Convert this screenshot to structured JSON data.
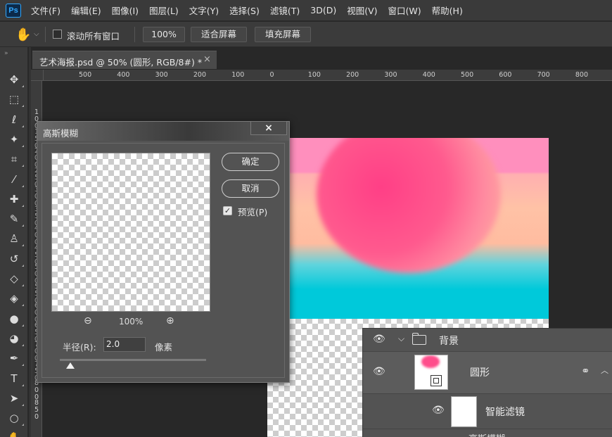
{
  "app": {
    "logo": "Ps"
  },
  "menu": [
    "文件(F)",
    "编辑(E)",
    "图像(I)",
    "图层(L)",
    "文字(Y)",
    "选择(S)",
    "滤镜(T)",
    "3D(D)",
    "视图(V)",
    "窗口(W)",
    "帮助(H)"
  ],
  "options": {
    "tool_icon": "hand-icon",
    "scroll_all_windows": "滚动所有窗口",
    "scroll_all_checked": false,
    "zoom_value": "100%",
    "fit_screen": "适合屏幕",
    "fill_screen": "填充屏幕"
  },
  "document": {
    "tab_title": "艺术海报.psd @ 50% (圆形, RGB/8#) *",
    "close": "×"
  },
  "rulers": {
    "top": [
      "500",
      "400",
      "300",
      "200",
      "100",
      "0",
      "100",
      "200",
      "300",
      "400",
      "500",
      "600",
      "700",
      "800"
    ],
    "left": [
      "1 0 0",
      "1 5 0",
      "2 0 0",
      "2 5 0",
      "3 0 0",
      "3 5 0",
      "4 0 0",
      "4 5 0",
      "5 0 0",
      "5 5 0",
      "6 0 0",
      "6 5 0",
      "7 0 0",
      "7 5 0",
      "8 0 0",
      "8 5 0"
    ]
  },
  "tools": [
    {
      "name": "move-icon",
      "glyph": "✥"
    },
    {
      "name": "marquee-icon",
      "glyph": "⬚"
    },
    {
      "name": "lasso-icon",
      "glyph": "ℓ"
    },
    {
      "name": "magic-wand-icon",
      "glyph": "✦"
    },
    {
      "name": "crop-icon",
      "glyph": "⌗"
    },
    {
      "name": "eyedropper-icon",
      "glyph": "⁄"
    },
    {
      "name": "healing-brush-icon",
      "glyph": "✚"
    },
    {
      "name": "brush-icon",
      "glyph": "✎"
    },
    {
      "name": "clone-stamp-icon",
      "glyph": "♙"
    },
    {
      "name": "history-brush-icon",
      "glyph": "↺"
    },
    {
      "name": "eraser-icon",
      "glyph": "◇"
    },
    {
      "name": "paint-bucket-icon",
      "glyph": "◈"
    },
    {
      "name": "blur-icon",
      "glyph": "●"
    },
    {
      "name": "dodge-icon",
      "glyph": "◕"
    },
    {
      "name": "pen-icon",
      "glyph": "✒"
    },
    {
      "name": "type-icon",
      "glyph": "T"
    },
    {
      "name": "path-selection-icon",
      "glyph": "➤"
    },
    {
      "name": "ellipse-icon",
      "glyph": "○"
    },
    {
      "name": "hand-icon",
      "glyph": "✋"
    }
  ],
  "dialog": {
    "title": "高斯模糊",
    "close": "×",
    "ok": "确定",
    "cancel": "取消",
    "preview_label": "预览(P)",
    "preview_checked": true,
    "zoom_out": "⊖",
    "zoom_level": "100%",
    "zoom_in": "⊕",
    "radius_label": "半径(R):",
    "radius_value": "2.0",
    "radius_unit": "像素",
    "slider_fraction": 0.07
  },
  "layers": {
    "group": {
      "name": "背景",
      "expanded": true
    },
    "circle": {
      "name": "圆形"
    },
    "smart_filters": {
      "name": "智能滤镜"
    },
    "next_partial": "高斯模糊"
  },
  "colors": {
    "accent": "#31a8ff",
    "poster_pink": "#ff8fbd",
    "poster_peach": "#ffc2a6",
    "poster_cyan": "#00c9da",
    "sun_pink": "#ff4d8b"
  }
}
